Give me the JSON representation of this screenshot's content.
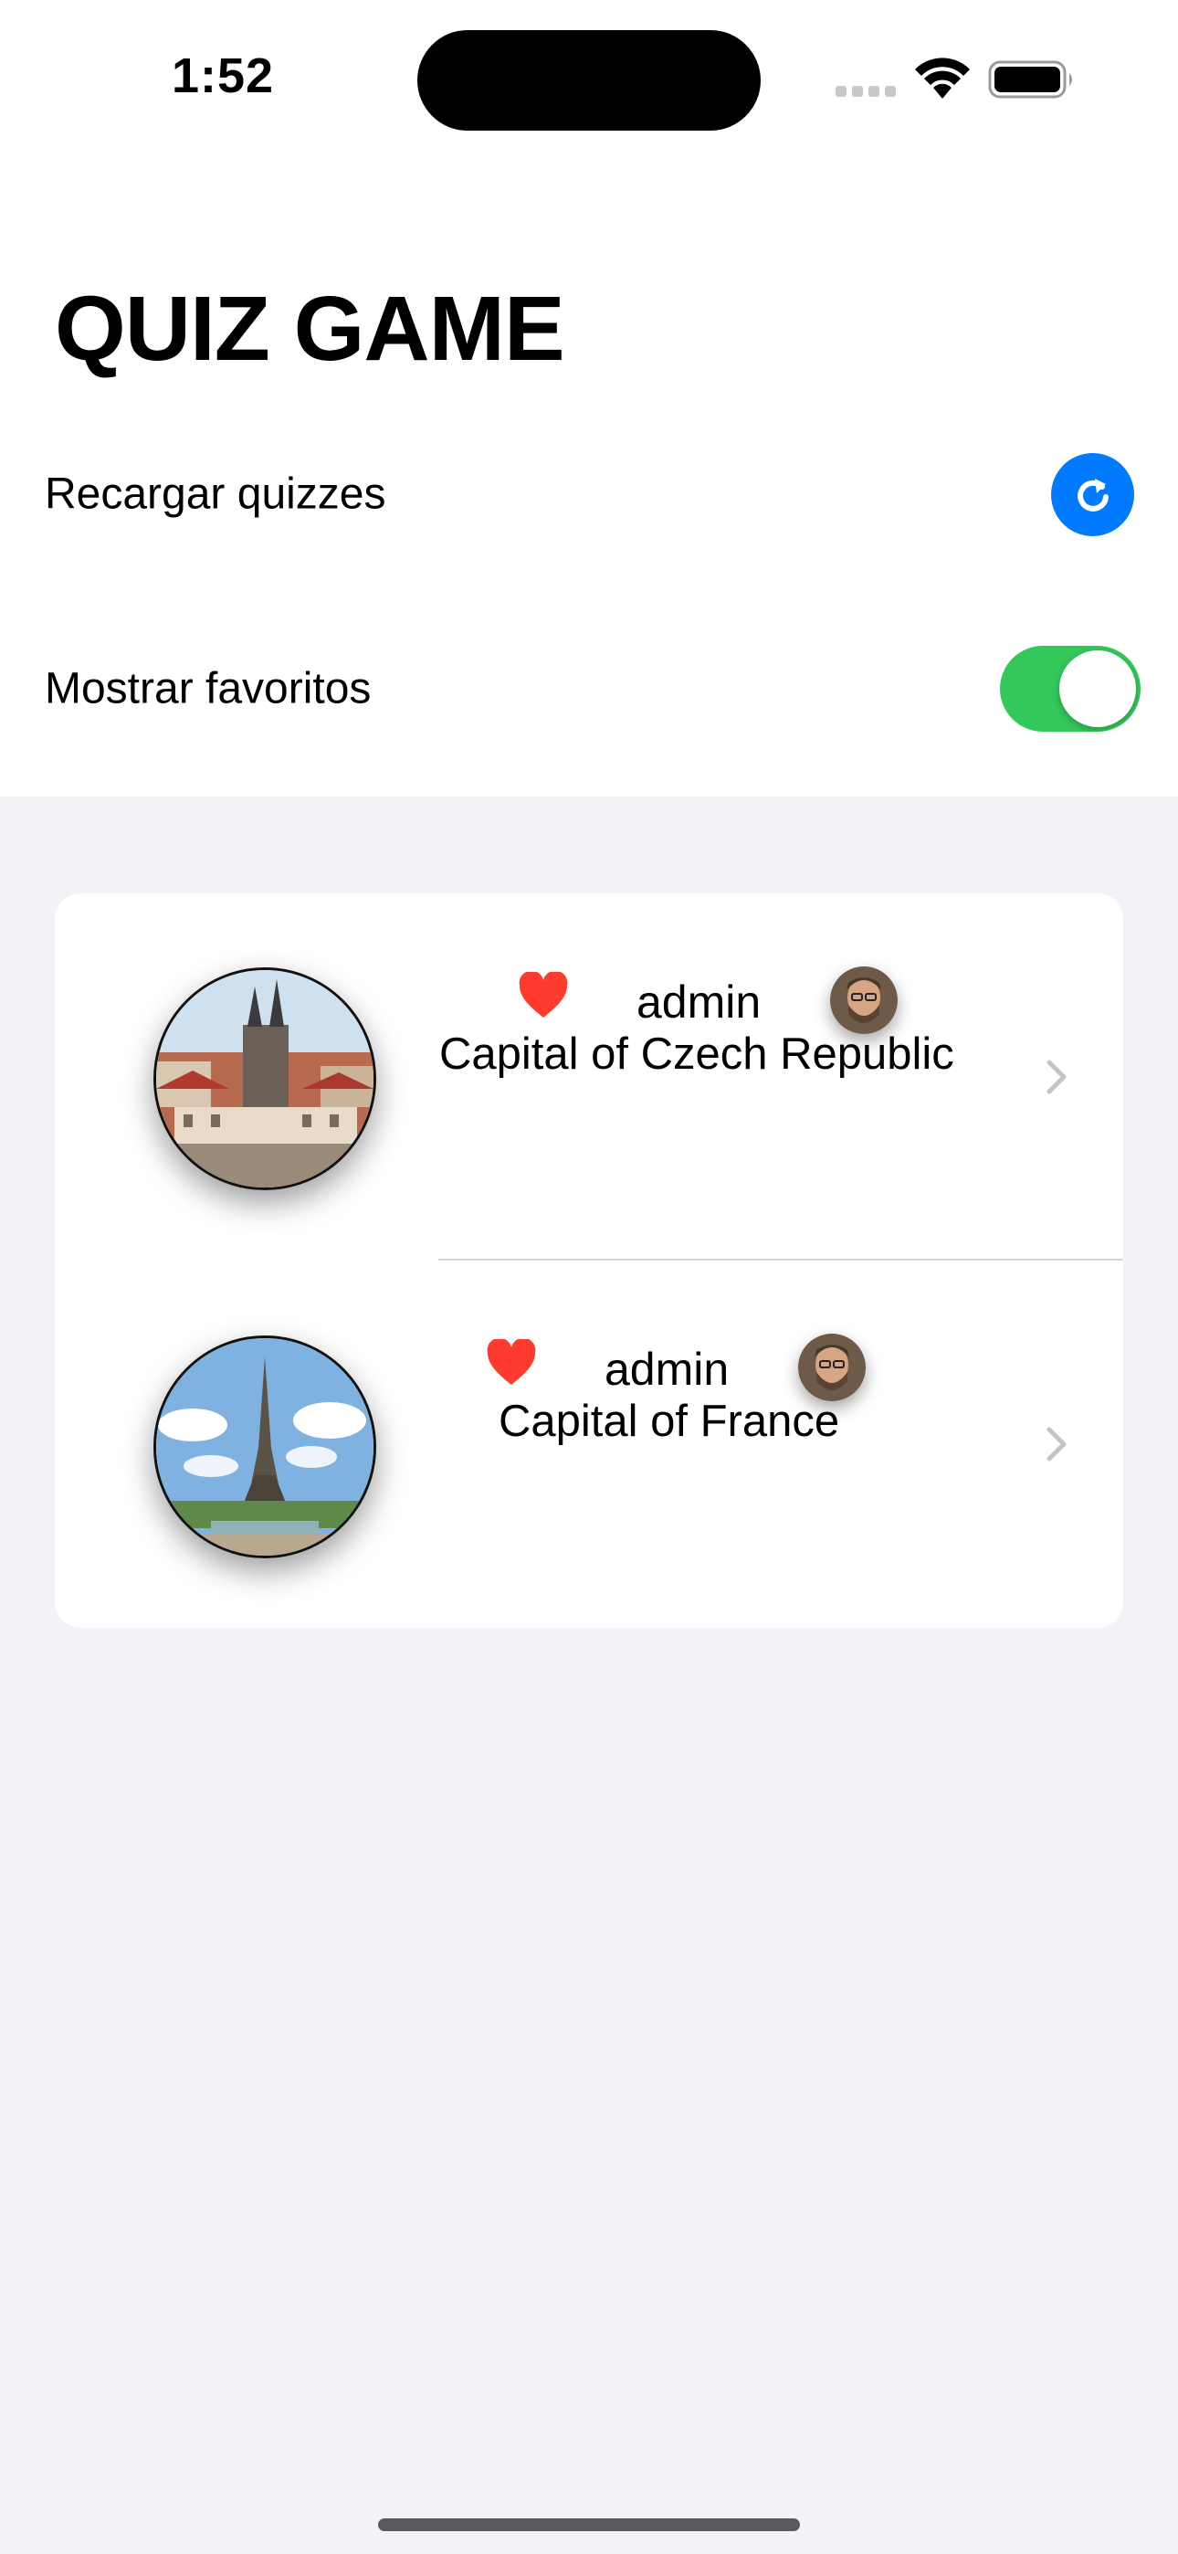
{
  "status_bar": {
    "time": "1:52",
    "icons": [
      "cellular-signal-icon",
      "wifi-icon",
      "battery-icon"
    ]
  },
  "header": {
    "title": "QUIZ GAME"
  },
  "settings": {
    "reload": {
      "label": "Recargar quizzes",
      "icon": "reload-icon"
    },
    "favorites": {
      "label": "Mostrar favoritos",
      "enabled": true
    }
  },
  "quizzes": [
    {
      "author": "admin",
      "question": "Capital of Czech Republic",
      "favorite": true,
      "image": "prague-old-town-photo",
      "avatar": "author-avatar"
    },
    {
      "author": "admin",
      "question": "Capital of France",
      "favorite": true,
      "image": "eiffel-tower-photo",
      "avatar": "author-avatar"
    }
  ],
  "colors": {
    "accent_blue": "#007aff",
    "toggle_green": "#34c759",
    "heart_red": "#ff3b30",
    "background": "#f2f2f7"
  }
}
